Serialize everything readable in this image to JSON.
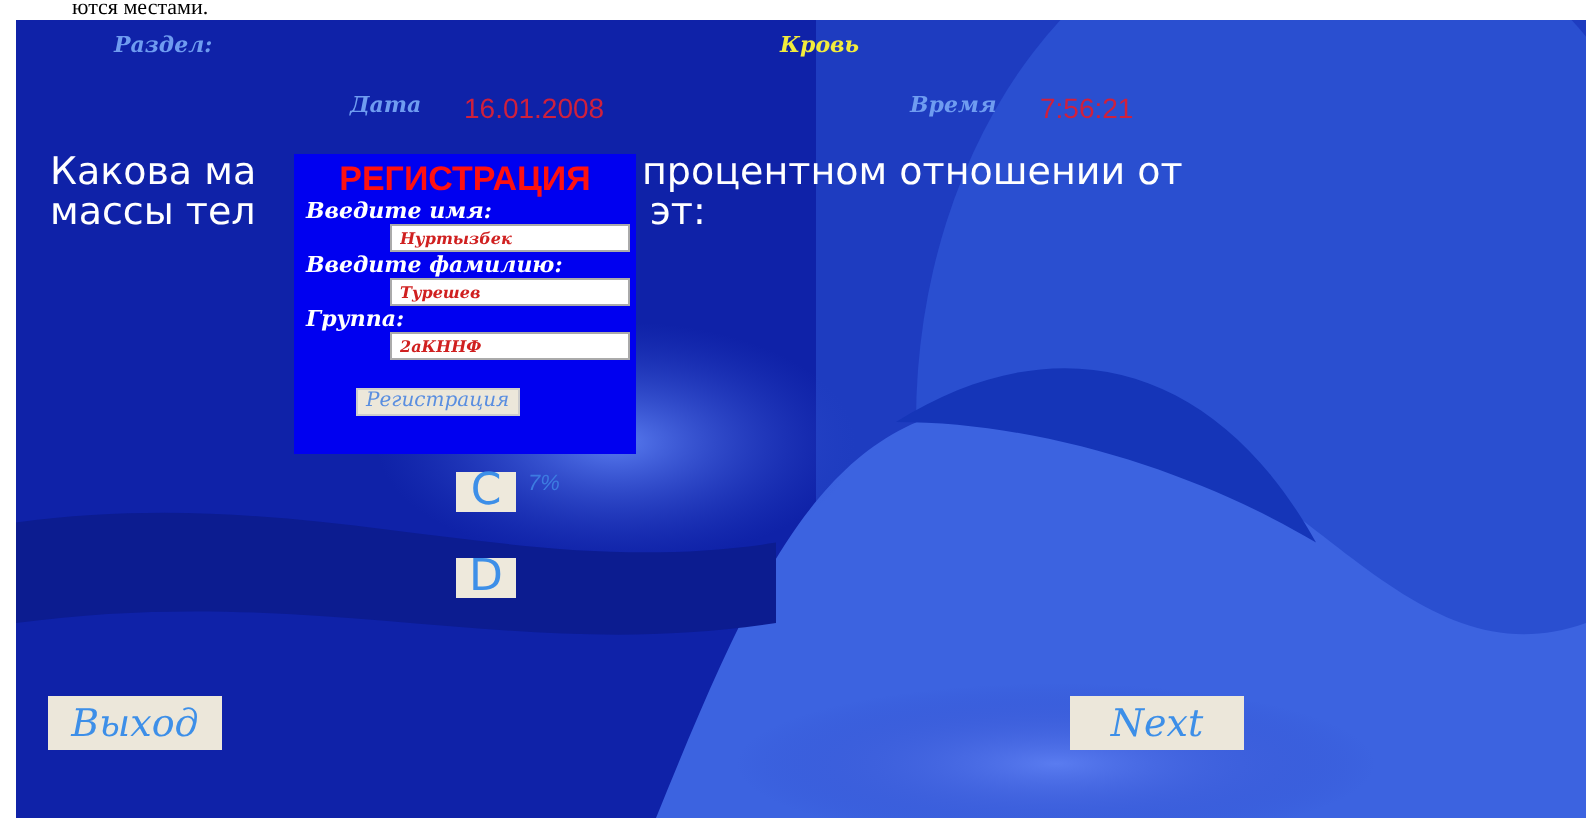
{
  "document_text": "ются местами.",
  "header": {
    "section_label": "Раздел:",
    "section_value": "Кровь",
    "date_label": "Дата",
    "date_value": "16.01.2008",
    "time_label": "Время",
    "time_value": "7:56:21"
  },
  "question": {
    "lines": [
      [
        "Какова ма",
        "процентном отношении от"
      ],
      [
        "массы тел",
        "эт:"
      ]
    ]
  },
  "answers": [
    {
      "letter": "C",
      "text": "7%"
    },
    {
      "letter": "D"
    }
  ],
  "registration": {
    "title": "РЕГИСТРАЦИЯ",
    "fields": [
      {
        "label": "Введите имя:",
        "value": "Нуртызбек"
      },
      {
        "label": "Введите фамилию:",
        "value": "Турешев"
      },
      {
        "label": "Группа:",
        "value": "2аКННФ"
      }
    ],
    "button": "Регистрация"
  },
  "buttons": {
    "exit": "Выход",
    "next": "Next"
  }
}
